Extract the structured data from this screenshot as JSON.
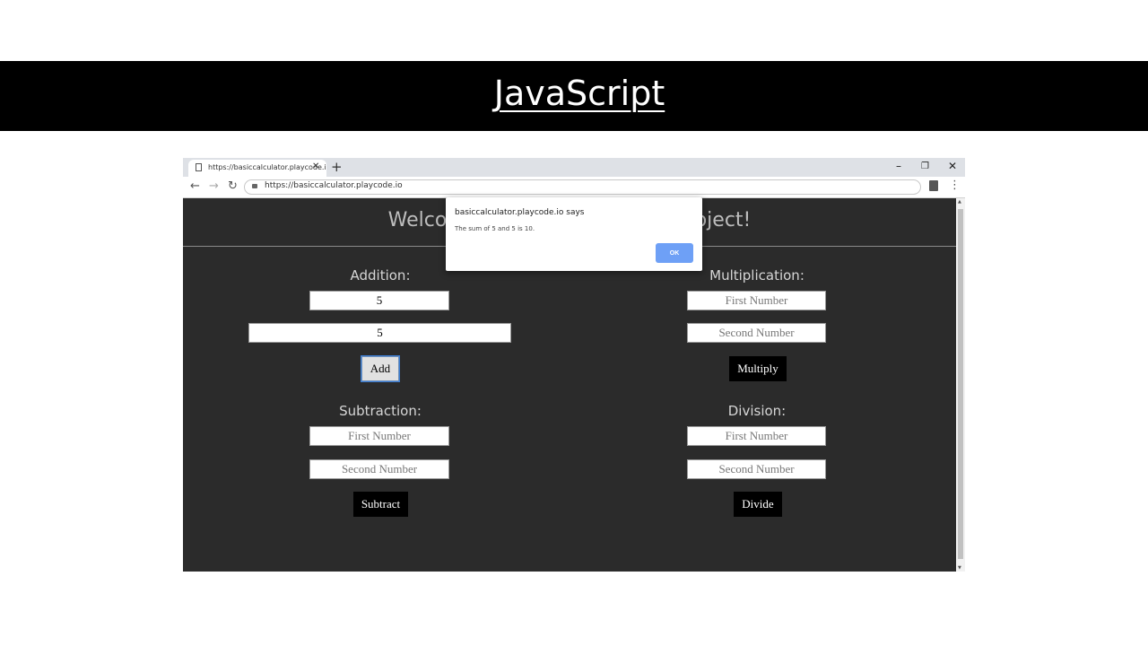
{
  "slide": {
    "title": "JavaScript"
  },
  "browser": {
    "tab_title": "https://basiccalculator.playcode.i",
    "url": "https://basiccalculator.playcode.io"
  },
  "page": {
    "heading": "Welcome to Basic Calculator Project!",
    "addition": {
      "label": "Addition:",
      "first_value": "5",
      "second_value": "5",
      "button": "Add"
    },
    "multiplication": {
      "label": "Multiplication:",
      "first_placeholder": "First Number",
      "second_placeholder": "Second Number",
      "button": "Multiply"
    },
    "subtraction": {
      "label": "Subtraction:",
      "first_placeholder": "First Number",
      "second_placeholder": "Second Number",
      "button": "Subtract"
    },
    "division": {
      "label": "Division:",
      "first_placeholder": "First Number",
      "second_placeholder": "Second Number",
      "button": "Divide"
    }
  },
  "dialog": {
    "title": "basiccalculator.playcode.io says",
    "message": "The sum of 5 and 5 is 10.",
    "ok": "OK"
  },
  "icons": {
    "back": "back-arrow-icon",
    "forward": "forward-arrow-icon",
    "reload": "reload-icon",
    "lock": "lock-icon",
    "menu": "kebab-menu-icon"
  },
  "colors": {
    "page_background": "#2b2b2b",
    "dialog_button": "#6ea0f6",
    "banner": "#000000"
  }
}
